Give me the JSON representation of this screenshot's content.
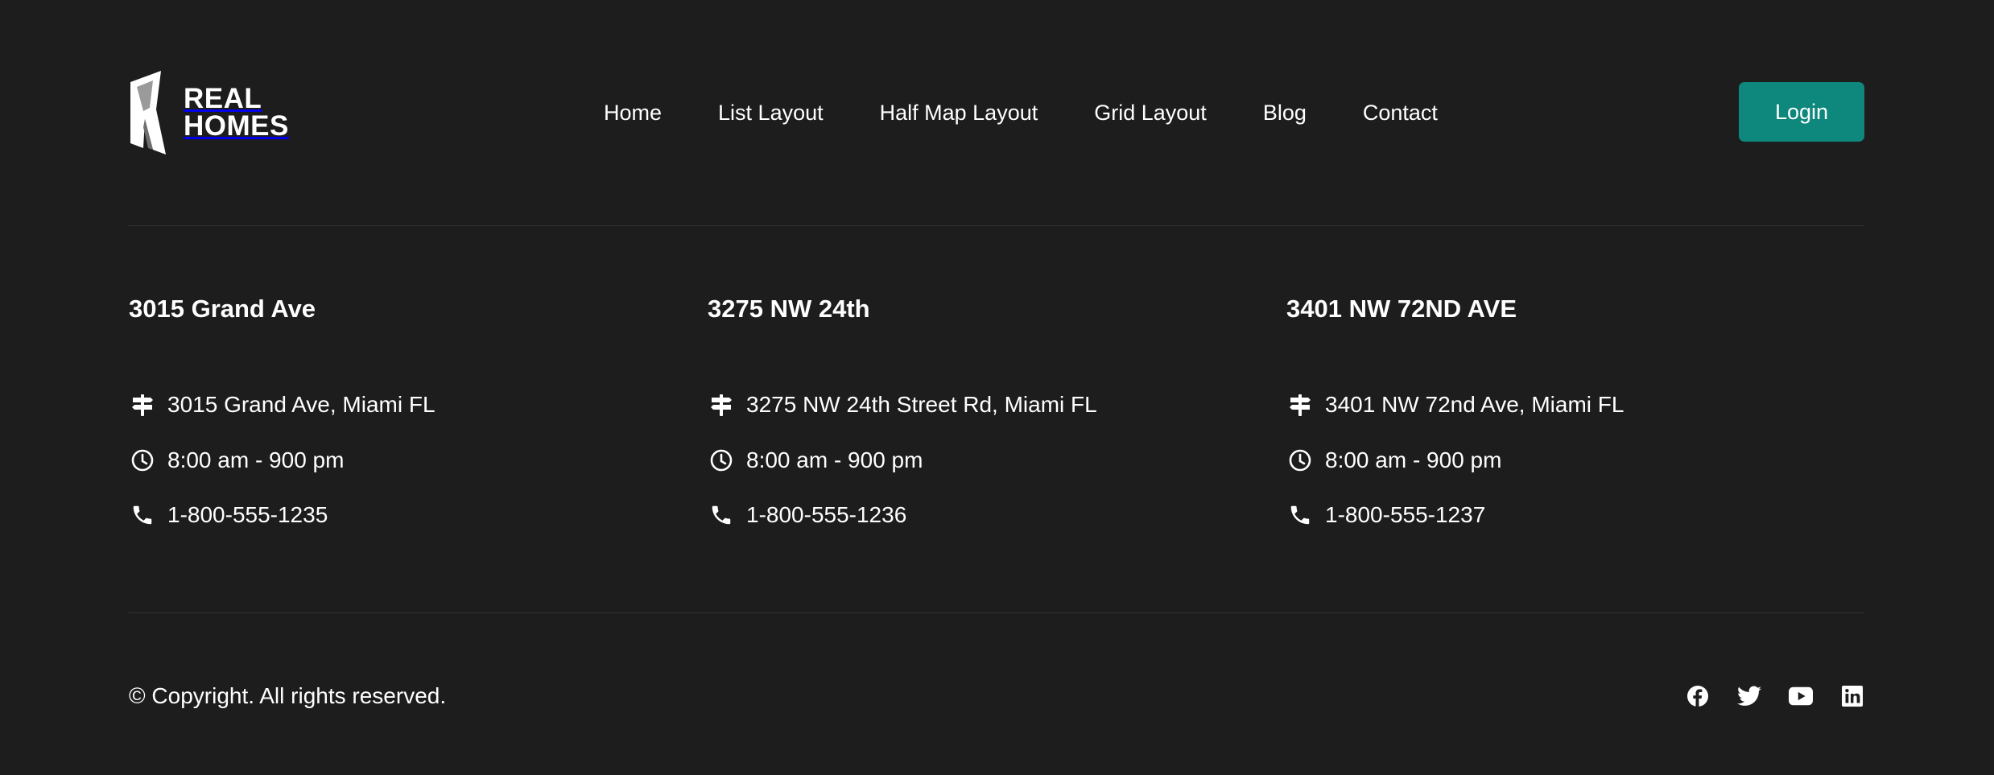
{
  "brand": {
    "line1": "REAL",
    "line2": "HOMES",
    "logo_icon": "real-homes-logo-mark"
  },
  "nav": {
    "items": [
      {
        "label": "Home"
      },
      {
        "label": "List Layout"
      },
      {
        "label": "Half Map Layout"
      },
      {
        "label": "Grid Layout"
      },
      {
        "label": "Blog"
      },
      {
        "label": "Contact"
      }
    ]
  },
  "login": {
    "label": "Login",
    "color": "#0e877c"
  },
  "locations": [
    {
      "title": "3015 Grand Ave",
      "address": "3015 Grand Ave, Miami FL",
      "hours": "8:00 am - 900 pm",
      "phone": "1-800-555-1235"
    },
    {
      "title": "3275 NW 24th",
      "address": "3275 NW 24th Street Rd, Miami FL",
      "hours": "8:00 am - 900 pm",
      "phone": "1-800-555-1236"
    },
    {
      "title": "3401 NW 72ND AVE",
      "address": "3401 NW 72nd Ave, Miami FL",
      "hours": "8:00 am - 900 pm",
      "phone": "1-800-555-1237"
    }
  ],
  "footer": {
    "copyright": "© Copyright. All rights reserved.",
    "socials": [
      "facebook-icon",
      "twitter-icon",
      "youtube-icon",
      "linkedin-icon"
    ]
  },
  "colors": {
    "background": "#1e1d1e",
    "divider": "#333233",
    "accent": "#0e877c",
    "text": "#ffffff"
  }
}
